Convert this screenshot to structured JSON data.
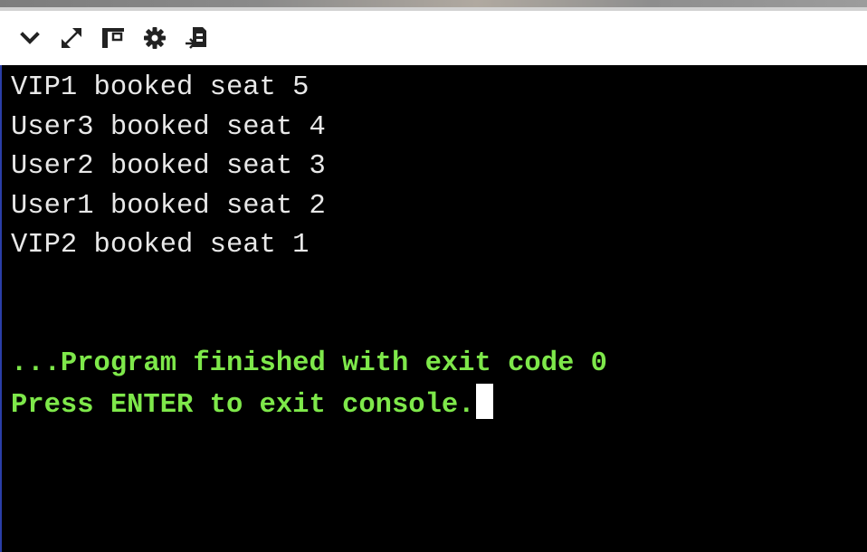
{
  "toolbar": {
    "buttons": [
      {
        "name": "collapse",
        "icon": "chevron-down-icon"
      },
      {
        "name": "expand",
        "icon": "expand-arrows-icon"
      },
      {
        "name": "layout",
        "icon": "panel-layout-icon"
      },
      {
        "name": "settings",
        "icon": "gear-icon"
      },
      {
        "name": "input-output",
        "icon": "file-input-icon"
      }
    ]
  },
  "console": {
    "output_lines": [
      "VIP1 booked seat 5",
      "User3 booked seat 4",
      "User2 booked seat 3",
      "User1 booked seat 2",
      "VIP2 booked seat 1"
    ],
    "exit_message": "...Program finished with exit code 0",
    "prompt_message": "Press ENTER to exit console."
  },
  "colors": {
    "console_background": "#000000",
    "output_text": "#e8e8e8",
    "status_text": "#7ee84a",
    "toolbar_background": "#ffffff",
    "icon_color": "#222222"
  }
}
